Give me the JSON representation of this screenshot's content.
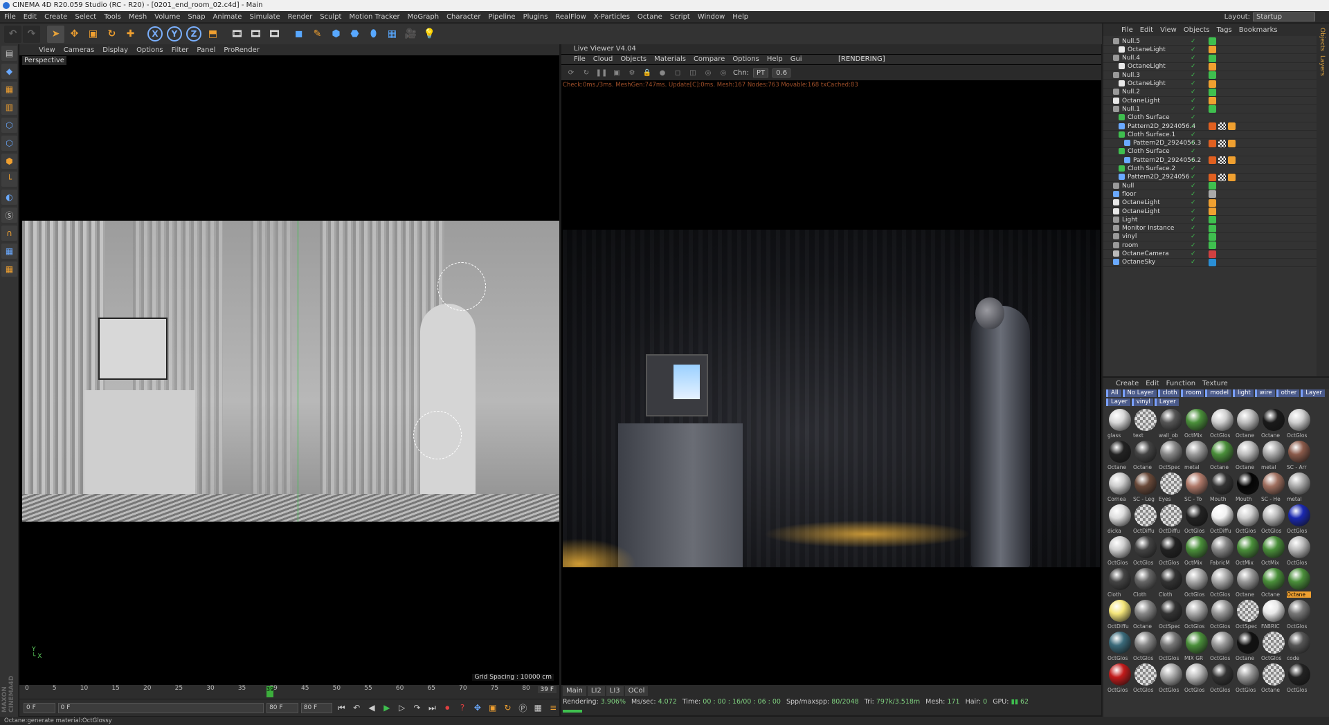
{
  "window_title": "CINEMA 4D R20.059 Studio (RC - R20) - [0201_end_room_02.c4d] - Main",
  "layout_label": "Layout:",
  "layout_value": "Startup",
  "menu": [
    "File",
    "Edit",
    "Create",
    "Select",
    "Tools",
    "Mesh",
    "Volume",
    "Snap",
    "Animate",
    "Simulate",
    "Render",
    "Sculpt",
    "Motion Tracker",
    "MoGraph",
    "Character",
    "Pipeline",
    "Plugins",
    "RealFlow",
    "X-Particles",
    "Octane",
    "Script",
    "Window",
    "Help"
  ],
  "toolbar": {
    "axis_x": "X",
    "axis_y": "Y",
    "axis_z": "Z"
  },
  "viewport": {
    "menu": [
      "View",
      "Cameras",
      "Display",
      "Options",
      "Filter",
      "Panel",
      "ProRender"
    ],
    "label": "Perspective",
    "grid_spacing": "Grid Spacing : 10000 cm"
  },
  "live_viewer": {
    "title": "Live Viewer V4.04",
    "menu": [
      "File",
      "Cloud",
      "Objects",
      "Materials",
      "Compare",
      "Options",
      "Help",
      "Gui"
    ],
    "status": "[RENDERING]",
    "chn_label": "Chn:",
    "chn_value": "PT",
    "chn_value2": "0.6",
    "info": "Check:0ms./3ms. MeshGen:747ms. Update[C]:0ms. Mesh:167 Nodes:763 Movable:168 txCached:83",
    "tabs": [
      "Main",
      "LI2",
      "LI3",
      "OCol"
    ],
    "stats": {
      "rendering": "Rendering:",
      "rendering_pct": "3.906%",
      "mssec_label": "Ms/sec:",
      "mssec": "4.072",
      "time_label": "Time:",
      "time": "00 : 00 : 16/00 : 06 : 00",
      "spp_label": "Spp/maxspp:",
      "spp": "80/2048",
      "tri_label": "Tri:",
      "tri": "797k/3.518m",
      "mesh_label": "Mesh:",
      "mesh": "171",
      "hair_label": "Hair:",
      "hair": "0",
      "gpu_label": "GPU:",
      "gpu": "62"
    }
  },
  "timeline": {
    "ticks": [
      "0",
      "5",
      "10",
      "15",
      "20",
      "25",
      "30",
      "35",
      "39",
      "45",
      "50",
      "55",
      "60",
      "65",
      "70",
      "75",
      "80"
    ],
    "current": "39",
    "frame_display": "39 F",
    "start_field": "0 F",
    "start_field2": "0 F",
    "end_field": "80 F",
    "end_field2": "80 F"
  },
  "status_bar": "Octane:generate material:OctGlossy",
  "object_manager": {
    "menu": [
      "File",
      "Edit",
      "View",
      "Objects",
      "Tags",
      "Bookmarks"
    ],
    "rows": [
      {
        "name": "Null.5",
        "indent": 0,
        "icon": "null"
      },
      {
        "name": "OctaneLight",
        "indent": 1,
        "icon": "light"
      },
      {
        "name": "Null.4",
        "indent": 0,
        "icon": "null"
      },
      {
        "name": "OctaneLight",
        "indent": 1,
        "icon": "light"
      },
      {
        "name": "Null.3",
        "indent": 0,
        "icon": "null"
      },
      {
        "name": "OctaneLight",
        "indent": 1,
        "icon": "light"
      },
      {
        "name": "Null.2",
        "indent": 0,
        "icon": "null"
      },
      {
        "name": "OctaneLight",
        "indent": 0,
        "icon": "light"
      },
      {
        "name": "Null.1",
        "indent": 0,
        "icon": "null"
      },
      {
        "name": "Cloth Surface",
        "indent": 1,
        "icon": "cloth"
      },
      {
        "name": "Pattern2D_2924056.4",
        "indent": 1,
        "icon": "pattern"
      },
      {
        "name": "Cloth Surface.1",
        "indent": 1,
        "icon": "cloth"
      },
      {
        "name": "Pattern2D_2924056.3",
        "indent": 2,
        "icon": "pattern"
      },
      {
        "name": "Cloth Surface",
        "indent": 1,
        "icon": "cloth"
      },
      {
        "name": "Pattern2D_2924056.2",
        "indent": 2,
        "icon": "pattern"
      },
      {
        "name": "Cloth Surface.2",
        "indent": 1,
        "icon": "cloth"
      },
      {
        "name": "Pattern2D_2924056",
        "indent": 1,
        "icon": "pattern"
      },
      {
        "name": "Null",
        "indent": 0,
        "icon": "null"
      },
      {
        "name": "floor",
        "indent": 0,
        "icon": "object"
      },
      {
        "name": "OctaneLight",
        "indent": 0,
        "icon": "light"
      },
      {
        "name": "OctaneLight",
        "indent": 0,
        "icon": "light"
      },
      {
        "name": "Light",
        "indent": 0,
        "icon": "null"
      },
      {
        "name": "Monitor Instance",
        "indent": 0,
        "icon": "null"
      },
      {
        "name": "vinyl",
        "indent": 0,
        "icon": "null"
      },
      {
        "name": "room",
        "indent": 0,
        "icon": "null"
      },
      {
        "name": "OctaneCamera",
        "indent": 0,
        "icon": "camera"
      },
      {
        "name": "OctaneSky",
        "indent": 0,
        "icon": "sky"
      }
    ]
  },
  "om_rail": [
    "Objects",
    "Layers"
  ],
  "material_manager": {
    "menu": [
      "Create",
      "Edit",
      "Function",
      "Texture"
    ],
    "layers": [
      "All",
      "No Layer",
      "cloth",
      "room",
      "model",
      "light",
      "wire",
      "other",
      "Layer",
      "Layer",
      "vinyl",
      "Layer"
    ],
    "materials": [
      {
        "label": "glass",
        "color": "#d8d8d8"
      },
      {
        "label": "text",
        "color": "checker"
      },
      {
        "label": "wall_ob",
        "color": "#555"
      },
      {
        "label": "OctMix",
        "color": "#4a8f3a"
      },
      {
        "label": "OctGlos",
        "color": "#cfcfcf"
      },
      {
        "label": "Octane",
        "color": "#bdbdbd"
      },
      {
        "label": "Octane",
        "color": "#1a1a1a"
      },
      {
        "label": "OctGlos",
        "color": "#cfcfcf"
      },
      {
        "label": "Octane",
        "color": "#222"
      },
      {
        "label": "Octane",
        "color": "#444"
      },
      {
        "label": "OctSpec",
        "color": "#888"
      },
      {
        "label": "metal",
        "color": "#9a9a9a"
      },
      {
        "label": "Octane",
        "color": "#4a8f3a"
      },
      {
        "label": "Octane",
        "color": "#bdbdbd"
      },
      {
        "label": "metal",
        "color": "#aaa"
      },
      {
        "label": "SC - Arr",
        "color": "#8a5a4a"
      },
      {
        "label": "Cornea",
        "color": "#ccc"
      },
      {
        "label": "SC - Leg",
        "color": "#6a4a3a"
      },
      {
        "label": "Eyes",
        "color": "checker"
      },
      {
        "label": "SC - To",
        "color": "#b07a6a"
      },
      {
        "label": "Mouth",
        "color": "#333"
      },
      {
        "label": "Mouth",
        "color": "#050505"
      },
      {
        "label": "SC - He",
        "color": "#a07060"
      },
      {
        "label": "metal",
        "color": "#aaa"
      },
      {
        "label": "dicka",
        "color": "#ddd"
      },
      {
        "label": "OctDiffu",
        "color": "checker"
      },
      {
        "label": "OctDiffu",
        "color": "checker"
      },
      {
        "label": "OctGlos",
        "color": "#222"
      },
      {
        "label": "OctDiffu",
        "color": "#f2f2f2"
      },
      {
        "label": "OctGlos",
        "color": "#cfcfcf"
      },
      {
        "label": "OctGlos",
        "color": "#bbb"
      },
      {
        "label": "OctGlos",
        "color": "#1a28b0"
      },
      {
        "label": "OctGlos",
        "color": "#cfcfcf"
      },
      {
        "label": "OctGlos",
        "color": "#444"
      },
      {
        "label": "OctGlos",
        "color": "#222"
      },
      {
        "label": "OctMix",
        "color": "#4a8f3a"
      },
      {
        "label": "FabricM",
        "color": "#888"
      },
      {
        "label": "OctMix",
        "color": "#4a8f3a"
      },
      {
        "label": "OctMix",
        "color": "#4a8f3a"
      },
      {
        "label": "OctGlos",
        "color": "#bbb"
      },
      {
        "label": "Cloth",
        "color": "#444"
      },
      {
        "label": "Cloth",
        "color": "#666"
      },
      {
        "label": "Cloth",
        "color": "#333"
      },
      {
        "label": "OctGlos",
        "color": "#aaa"
      },
      {
        "label": "OctGlos",
        "color": "#aaa"
      },
      {
        "label": "Octane",
        "color": "#999"
      },
      {
        "label": "Octane",
        "color": "#4a8f3a"
      },
      {
        "label": "Octane",
        "color": "#4a8f3a"
      },
      {
        "label": "OctDiffu",
        "color": "#f5e67a"
      },
      {
        "label": "Octane",
        "color": "#888"
      },
      {
        "label": "OctSpec",
        "color": "#333"
      },
      {
        "label": "OctGlos",
        "color": "#aaa"
      },
      {
        "label": "OctGlos",
        "color": "#999"
      },
      {
        "label": "OctSpec",
        "color": "checker"
      },
      {
        "label": "FABRIC",
        "color": "#e8e8e8"
      },
      {
        "label": "OctGlos",
        "color": "#777"
      },
      {
        "label": "OctGlos",
        "color": "#3a6a7a"
      },
      {
        "label": "OctGlos",
        "color": "#888"
      },
      {
        "label": "OctGlos",
        "color": "#777"
      },
      {
        "label": "MIX GR",
        "color": "#4a8f3a"
      },
      {
        "label": "OctGlos",
        "color": "#999"
      },
      {
        "label": "Octane",
        "color": "#111"
      },
      {
        "label": "OctGlos",
        "color": "checker"
      },
      {
        "label": "code",
        "color": "#555"
      },
      {
        "label": "OctGlos",
        "color": "#c21a1a"
      },
      {
        "label": "OctGlos",
        "color": "checker"
      },
      {
        "label": "OctGlos",
        "color": "#aaa"
      },
      {
        "label": "OctGlos",
        "color": "#bbb"
      },
      {
        "label": "OctGlos",
        "color": "#333"
      },
      {
        "label": "OctGlos",
        "color": "#999"
      },
      {
        "label": "Octane",
        "color": "checker"
      },
      {
        "label": "OctGlos",
        "color": "#222"
      }
    ],
    "highlighted_label": "Octane"
  }
}
